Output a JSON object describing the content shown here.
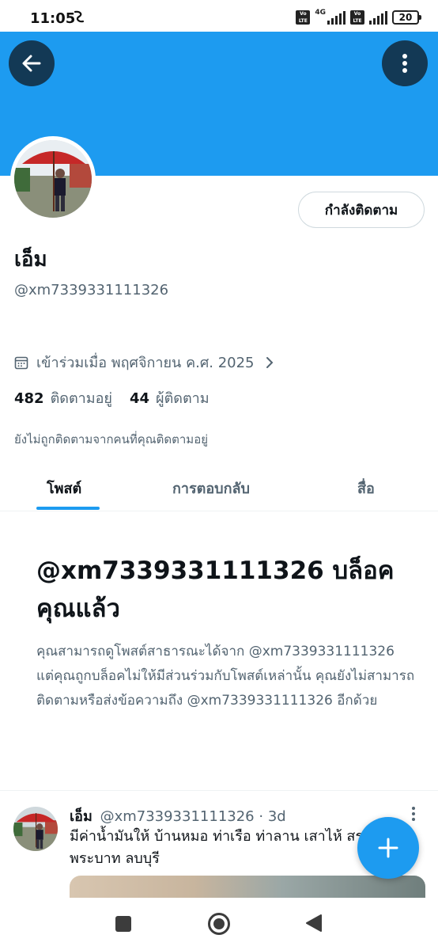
{
  "status_bar": {
    "time": "11:05",
    "volte_label": "Vo LTE",
    "network": "4G",
    "battery": "20"
  },
  "profile": {
    "name": "เอ็ม",
    "handle": "@xm7339331111326",
    "follow_button": "กำลังติดตาม",
    "joined": "เข้าร่วมเมื่อ พฤศจิกายน ค.ศ. 2025",
    "following_count": "482",
    "following_label": "ติดตามอยู่",
    "followers_count": "44",
    "followers_label": "ผู้ติดตาม",
    "not_followed_note": "ยังไม่ถูกติดตามจากคนที่คุณติดตามอยู่"
  },
  "tabs": [
    {
      "label": "โพสต์",
      "active": true
    },
    {
      "label": "การตอบกลับ",
      "active": false
    },
    {
      "label": "สื่อ",
      "active": false
    }
  ],
  "blocked": {
    "title": "@xm7339331111326 บล็อคคุณแล้ว",
    "body": "คุณสามารถดูโพสต์สาธารณะได้จาก @xm7339331111326 แต่คุณถูกบล็อคไม่ให้มีส่วนร่วมกับโพสต์เหล่านั้น คุณยังไม่สามารถติดตามหรือส่งข้อความถึง @xm7339331111326 อีกด้วย"
  },
  "tweet": {
    "name": "เอ็ม",
    "handle": "@xm7339331111326",
    "separator": "·",
    "time": "3d",
    "text": "มีค่าน้ำมันให้ บ้านหมอ ท่าเรือ ท่าลาน เสาไห้ สระบุรี พระบาท ลบบุรี"
  },
  "colors": {
    "accent": "#1d9bf0",
    "text_primary": "#0f1419",
    "text_secondary": "#536471"
  },
  "icons": [
    "back-arrow-icon",
    "more-vertical-icon",
    "calendar-icon",
    "chevron-right-icon",
    "plus-icon",
    "recent-apps-icon",
    "home-icon",
    "back-triangle-icon"
  ]
}
